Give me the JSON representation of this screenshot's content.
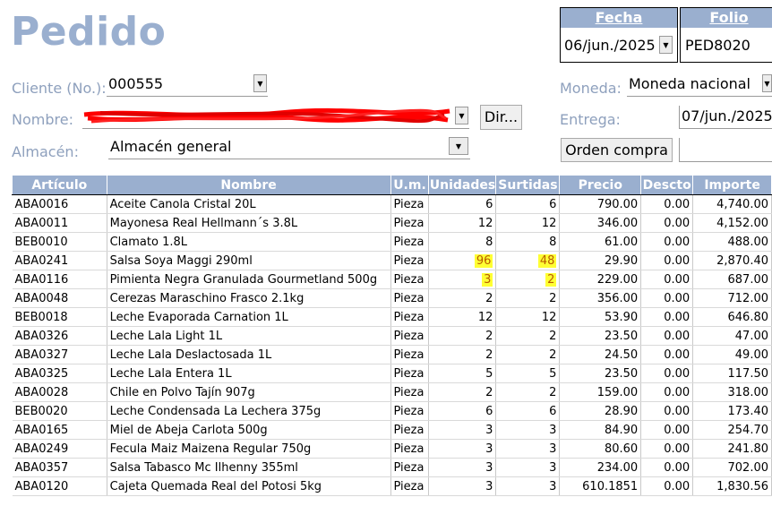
{
  "title": "Pedido",
  "fecha": {
    "label": "Fecha",
    "value": "06/jun./2025"
  },
  "folio": {
    "label": "Folio",
    "value": "PED8020"
  },
  "cliente": {
    "label": "Cliente (No.):",
    "value": "000555"
  },
  "nombre": {
    "label": "Nombre:",
    "dir_button": "Dir..."
  },
  "almacen": {
    "label": "Almacén:",
    "value": "Almacén general"
  },
  "moneda": {
    "label": "Moneda:",
    "value": "Moneda nacional"
  },
  "entrega": {
    "label": "Entrega:",
    "value": "07/jun./2025"
  },
  "orden_compra": {
    "button": "Orden compra"
  },
  "colors": {
    "accent": "#9aafcf",
    "highlight": "#ffff33",
    "highlight_text": "#b85c00",
    "redaction": "#ff0000"
  },
  "table": {
    "headers": [
      "Artículo",
      "Nombre",
      "U.m.",
      "Unidades",
      "Surtidas",
      "Precio",
      "Descto",
      "Importe"
    ],
    "rows": [
      [
        "ABA0016",
        "Aceite Canola Cristal 20L",
        "Pieza",
        "6",
        "6",
        "790.00",
        "0.00",
        "4,740.00"
      ],
      [
        "ABA0011",
        "Mayonesa Real Hellmann´s 3.8L",
        "Pieza",
        "12",
        "12",
        "346.00",
        "0.00",
        "4,152.00"
      ],
      [
        "BEB0010",
        "Clamato 1.8L",
        "Pieza",
        "8",
        "8",
        "61.00",
        "0.00",
        "488.00"
      ],
      [
        "ABA0241",
        "Salsa Soya Maggi 290ml",
        "Pieza",
        "96",
        "48",
        "29.90",
        "0.00",
        "2,870.40"
      ],
      [
        "ABA0116",
        "Pimienta Negra Granulada Gourmetland 500g",
        "Pieza",
        "3",
        "2",
        "229.00",
        "0.00",
        "687.00"
      ],
      [
        "ABA0048",
        "Cerezas Maraschino Frasco 2.1kg",
        "Pieza",
        "2",
        "2",
        "356.00",
        "0.00",
        "712.00"
      ],
      [
        "BEB0018",
        "Leche Evaporada Carnation 1L",
        "Pieza",
        "12",
        "12",
        "53.90",
        "0.00",
        "646.80"
      ],
      [
        "ABA0326",
        "Leche Lala Light 1L",
        "Pieza",
        "2",
        "2",
        "23.50",
        "0.00",
        "47.00"
      ],
      [
        "ABA0327",
        "Leche Lala Deslactosada 1L",
        "Pieza",
        "2",
        "2",
        "24.50",
        "0.00",
        "49.00"
      ],
      [
        "ABA0325",
        "Leche Lala Entera 1L",
        "Pieza",
        "5",
        "5",
        "23.50",
        "0.00",
        "117.50"
      ],
      [
        "ABA0028",
        "Chile en Polvo Tajín 907g",
        "Pieza",
        "2",
        "2",
        "159.00",
        "0.00",
        "318.00"
      ],
      [
        "BEB0020",
        "Leche Condensada La Lechera 375g",
        "Pieza",
        "6",
        "6",
        "28.90",
        "0.00",
        "173.40"
      ],
      [
        "ABA0165",
        "Miel de Abeja Carlota 500g",
        "Pieza",
        "3",
        "3",
        "84.90",
        "0.00",
        "254.70"
      ],
      [
        "ABA0249",
        "Fecula Maiz Maizena Regular 750g",
        "Pieza",
        "3",
        "3",
        "80.60",
        "0.00",
        "241.80"
      ],
      [
        "ABA0357",
        "Salsa Tabasco Mc Ilhenny 355ml",
        "Pieza",
        "3",
        "3",
        "234.00",
        "0.00",
        "702.00"
      ],
      [
        "ABA0120",
        "Cajeta Quemada Real del Potosi 5kg",
        "Pieza",
        "3",
        "3",
        "610.1851",
        "0.00",
        "1,830.56"
      ]
    ],
    "highlighted": [
      [
        3,
        3
      ],
      [
        3,
        4
      ],
      [
        4,
        3
      ],
      [
        4,
        4
      ]
    ]
  }
}
